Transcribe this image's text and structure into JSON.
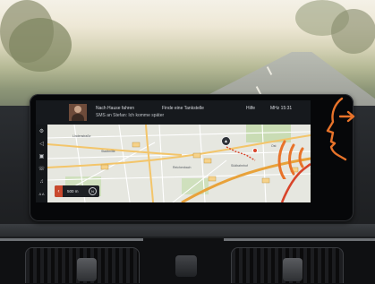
{
  "colors": {
    "accent": "#e8732a",
    "route": "#d8442a",
    "screen_bg": "#0d0f12",
    "header_text": "#d7dadf"
  },
  "header": {
    "contact_avatar_icon": "contact-avatar",
    "nav_home": "Nach Hause fahren",
    "find_gas": "Finde eine Tankstelle",
    "help": "Hilfe",
    "clock": "MHz 15:31",
    "sms_message": "SMS an Stefan: Ich komme später"
  },
  "sidebar": {
    "icons": [
      "settings-icon",
      "speaker-icon",
      "car-icon",
      "phone-icon",
      "media-icon",
      "text-size-icon"
    ],
    "text_size_label": "A A"
  },
  "map": {
    "scale_label": "500 m",
    "compass_label": "N",
    "labels": [
      "Stadtmitte",
      "Reichenbach",
      "Südbahnhof",
      "Ost",
      "Lindenstraße"
    ]
  },
  "voice": {
    "icon": "voice-control-icon"
  }
}
